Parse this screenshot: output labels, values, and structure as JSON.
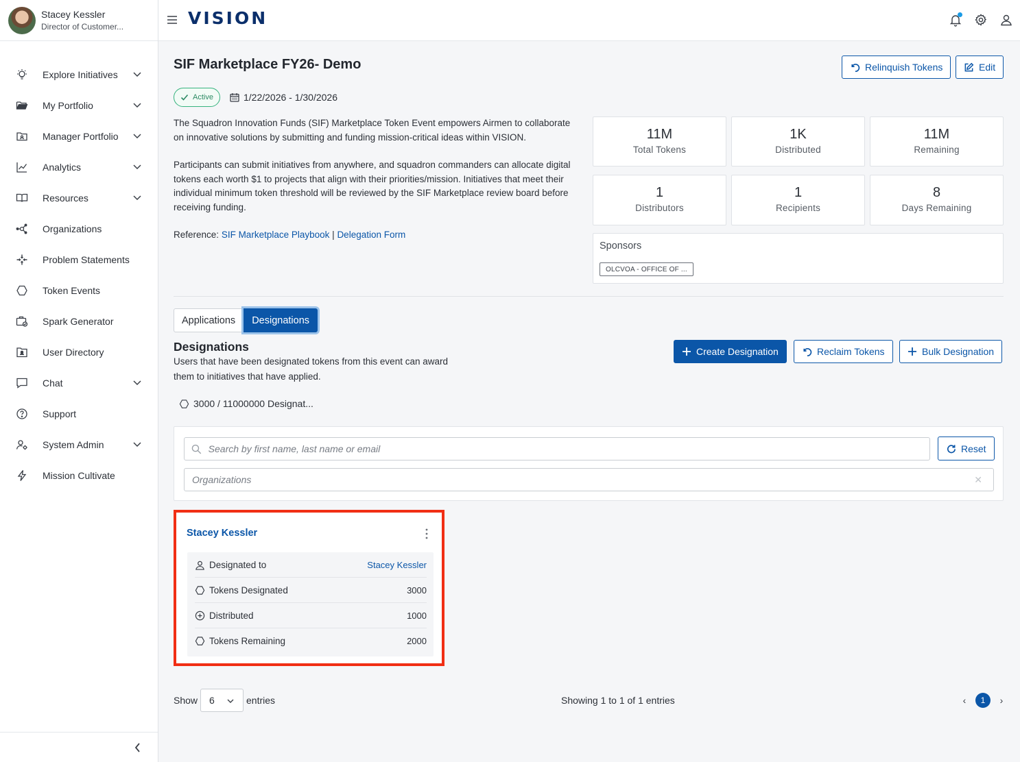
{
  "user": {
    "name": "Stacey Kessler",
    "role": "Director of Customer..."
  },
  "header": {
    "logo": "VISION"
  },
  "sidebar": {
    "items": [
      {
        "label": "Explore Initiatives",
        "icon": "lightbulb-icon",
        "has_chevron": true
      },
      {
        "label": "My Portfolio",
        "icon": "folder-open-icon",
        "has_chevron": true
      },
      {
        "label": "Manager Portfolio",
        "icon": "folder-user-icon",
        "has_chevron": true
      },
      {
        "label": "Analytics",
        "icon": "line-chart-icon",
        "has_chevron": true
      },
      {
        "label": "Resources",
        "icon": "book-icon",
        "has_chevron": true
      },
      {
        "label": "Organizations",
        "icon": "network-icon",
        "has_chevron": false
      },
      {
        "label": "Problem Statements",
        "icon": "arrows-inward-icon",
        "has_chevron": false
      },
      {
        "label": "Token Events",
        "icon": "hexagon-icon",
        "has_chevron": false
      },
      {
        "label": "Spark Generator",
        "icon": "briefcase-check-icon",
        "has_chevron": false
      },
      {
        "label": "User Directory",
        "icon": "contact-folder-icon",
        "has_chevron": false
      },
      {
        "label": "Chat",
        "icon": "chat-bubble-icon",
        "has_chevron": true
      },
      {
        "label": "Support",
        "icon": "help-circle-icon",
        "has_chevron": false
      },
      {
        "label": "System Admin",
        "icon": "user-gear-icon",
        "has_chevron": true
      },
      {
        "label": "Mission Cultivate",
        "icon": "lightning-icon",
        "has_chevron": false
      }
    ]
  },
  "event": {
    "title": "SIF Marketplace FY26- Demo",
    "status": "Active",
    "date_range": "1/22/2026 - 1/30/2026",
    "description_1": "The Squadron Innovation Funds (SIF) Marketplace Token Event empowers Airmen to collaborate on innovative solutions by submitting and funding mission-critical ideas within VISION.",
    "description_2": "Participants can submit initiatives from anywhere, and squadron commanders can allocate digital tokens each worth $1 to projects that align with their priorities/mission. Initiatives that meet their individual minimum token threshold will be reviewed by the SIF Marketplace review board before receiving funding.",
    "reference_label": "Reference:",
    "reference_link_1": "SIF Marketplace Playbook",
    "reference_separator": "|",
    "reference_link_2": "Delegation Form",
    "relinquish_label": "Relinquish Tokens",
    "edit_label": "Edit"
  },
  "stats": [
    {
      "value": "11M",
      "label": "Total Tokens"
    },
    {
      "value": "1K",
      "label": "Distributed"
    },
    {
      "value": "11M",
      "label": "Remaining"
    },
    {
      "value": "1",
      "label": "Distributors"
    },
    {
      "value": "1",
      "label": "Recipients"
    },
    {
      "value": "8",
      "label": "Days Remaining"
    }
  ],
  "sponsors": {
    "title": "Sponsors",
    "chip": "OLCVOA - OFFICE OF ..."
  },
  "tabs": [
    {
      "label": "Applications",
      "active": false
    },
    {
      "label": "Designations",
      "active": true
    }
  ],
  "designations": {
    "title": "Designations",
    "description": "Users that have been designated tokens from this event can award them to initiatives that have applied.",
    "create_label": "Create Designation",
    "reclaim_label": "Reclaim Tokens",
    "bulk_label": "Bulk Designation",
    "progress_text": "3000 / 11000000 Designat..."
  },
  "filters": {
    "search_placeholder": "Search by first name, last name or email",
    "org_placeholder": "Organizations",
    "reset_label": "Reset"
  },
  "card": {
    "name": "Stacey Kessler",
    "rows": [
      {
        "label": "Designated to",
        "value": "Stacey Kessler"
      },
      {
        "label": "Tokens Designated",
        "value": "3000"
      },
      {
        "label": "Distributed",
        "value": "1000"
      },
      {
        "label": "Tokens Remaining",
        "value": "2000"
      }
    ]
  },
  "pagination": {
    "show_label": "Show",
    "page_size": "6",
    "entries_label": "entries",
    "showing_text": "Showing 1 to 1 of 1 entries",
    "current_page": "1",
    "prev": "‹",
    "next": "›"
  },
  "colors": {
    "primary": "#0b56a8",
    "active_green": "#36b37e",
    "highlight_red": "#f12e14",
    "logo_navy": "#0b2f6b"
  }
}
